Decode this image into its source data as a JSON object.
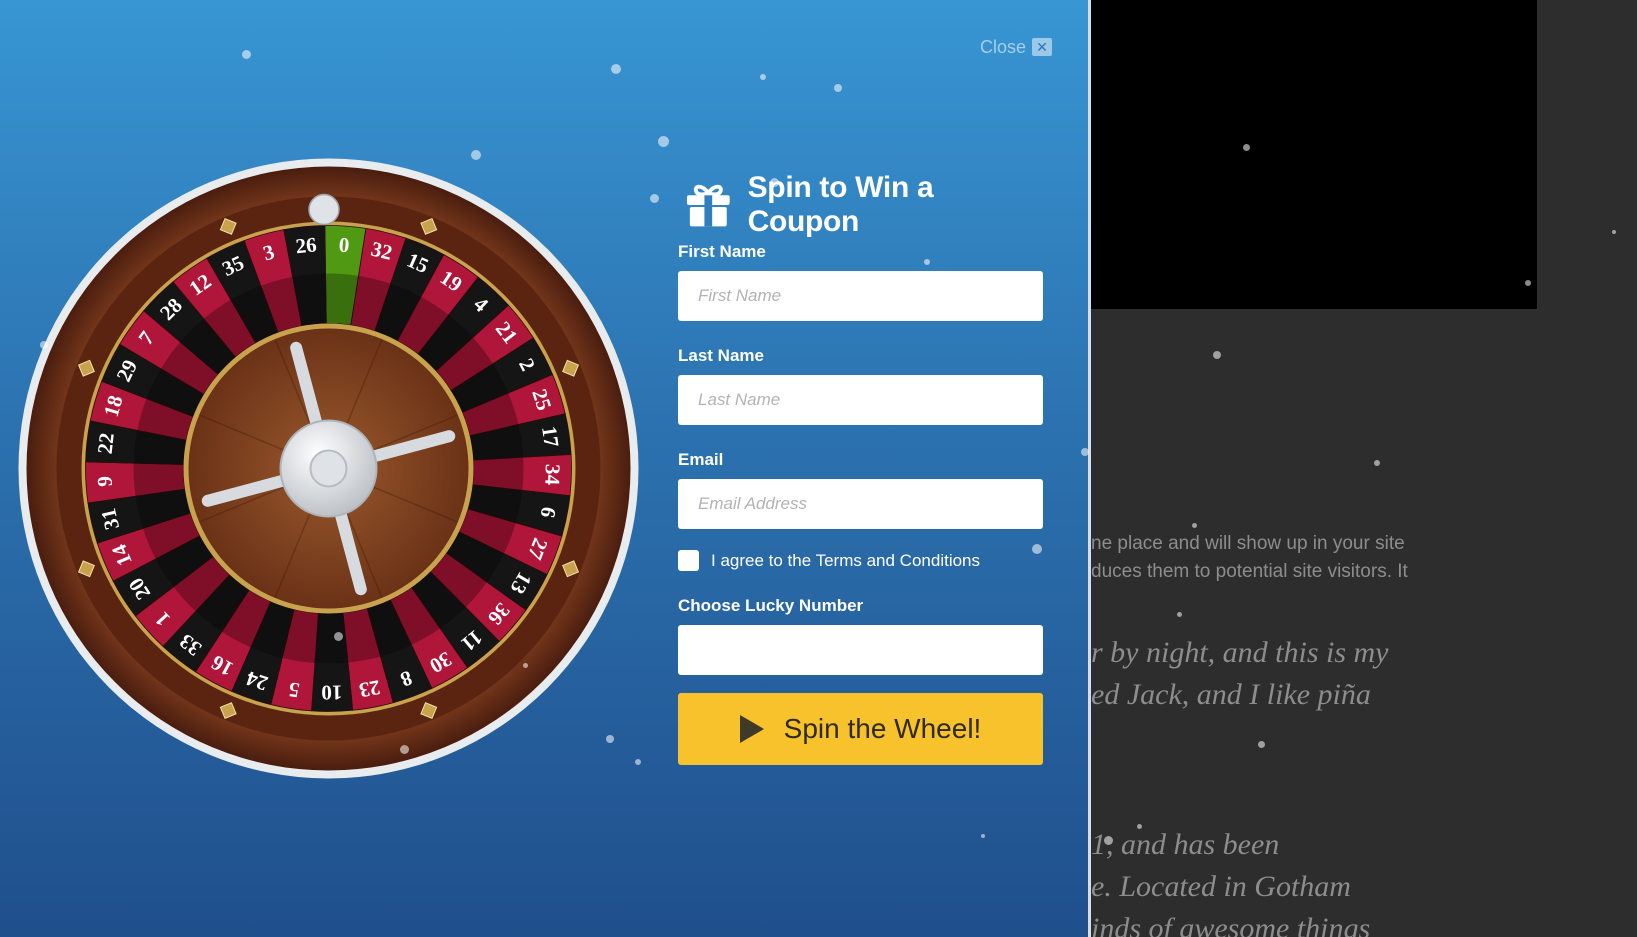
{
  "background": {
    "paragraph_lines": [
      "ne place and will show up in your site",
      "duces them to potential site visitors. It"
    ],
    "quote_lines_a": [
      "r by night, and this is my",
      "ed Jack, and I like piña"
    ],
    "quote_lines_b": [
      "1, and has been",
      "e. Located in Gotham",
      "inds of awesome things"
    ]
  },
  "modal": {
    "close_label": "Close",
    "close_glyph": "✕",
    "title": "Spin to Win a Coupon",
    "fields": {
      "first_name": {
        "label": "First Name",
        "placeholder": "First Name",
        "value": ""
      },
      "last_name": {
        "label": "Last Name",
        "placeholder": "Last Name",
        "value": ""
      },
      "email": {
        "label": "Email",
        "placeholder": "Email Address",
        "value": ""
      },
      "lucky_number": {
        "label": "Choose Lucky Number",
        "placeholder": "",
        "value": ""
      }
    },
    "agree_label": "I agree to the Terms and Conditions",
    "agree_checked": false,
    "spin_button_label": "Spin the Wheel!"
  },
  "wheel": {
    "numbers": [
      "0",
      "32",
      "15",
      "19",
      "4",
      "21",
      "2",
      "25",
      "17",
      "34",
      "6",
      "27",
      "13",
      "36",
      "11",
      "30",
      "8",
      "23",
      "10",
      "5",
      "24",
      "16",
      "33",
      "1",
      "20",
      "14",
      "31",
      "9",
      "22",
      "18",
      "29",
      "7",
      "28",
      "12",
      "35",
      "3",
      "26"
    ],
    "colors": {
      "red": "#b0163a",
      "black": "#151515",
      "green": "#4f9a12",
      "wood_dark": "#4a1d0f",
      "wood_mid": "#7a3a1c",
      "gold": "#c9a24e",
      "button_yellow": "#f7c22b"
    }
  },
  "icons": {
    "gift": "gift-icon",
    "play": "play-icon",
    "close": "close-icon"
  }
}
